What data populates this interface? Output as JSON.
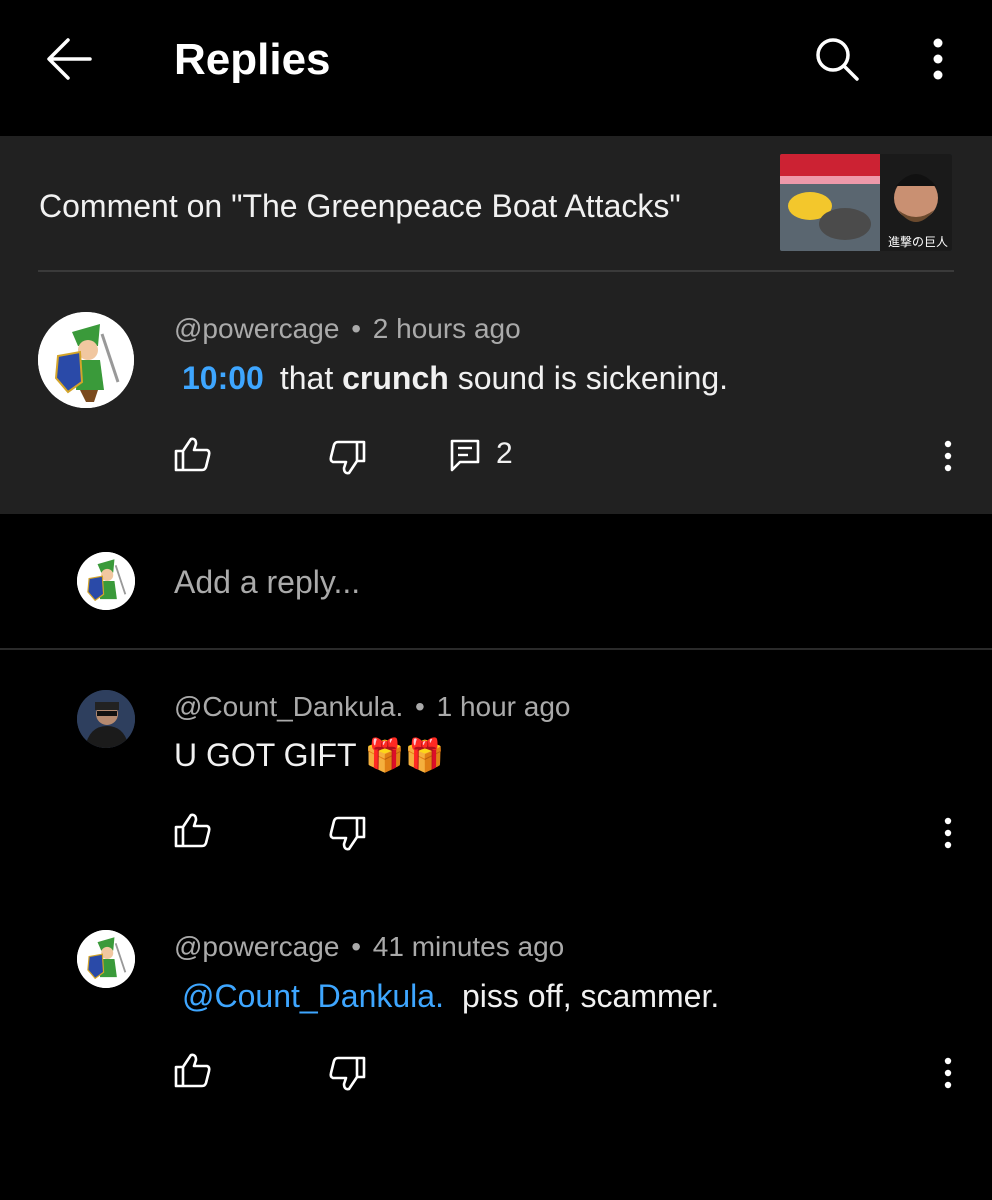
{
  "header": {
    "title": "Replies"
  },
  "context": {
    "label": "Comment on \"The Greenpeace Boat Attacks\""
  },
  "parent_comment": {
    "author": "@powercage",
    "sep": "•",
    "time": "2 hours ago",
    "timestamp_link": "10:00",
    "text_before": "that ",
    "text_bold": "crunch",
    "text_after": " sound is sickening.",
    "reply_count": "2"
  },
  "reply_box": {
    "placeholder": "Add a reply..."
  },
  "replies": [
    {
      "author": "@Count_Dankula.",
      "sep": "•",
      "time": "1 hour ago",
      "text": "U GOT GIFT 🎁🎁"
    },
    {
      "author": "@powercage",
      "sep": "•",
      "time": "41 minutes ago",
      "mention": "@Count_Dankula.",
      "text": "piss off, scammer."
    }
  ],
  "icons": {
    "back": "arrow-left-icon",
    "search": "search-icon",
    "more": "more-vertical-icon",
    "like": "thumbs-up-icon",
    "dislike": "thumbs-down-icon",
    "reply": "comment-icon"
  },
  "colors": {
    "background": "#000000",
    "card": "#212121",
    "link": "#3ea6ff",
    "meta": "#aaaaaa"
  }
}
